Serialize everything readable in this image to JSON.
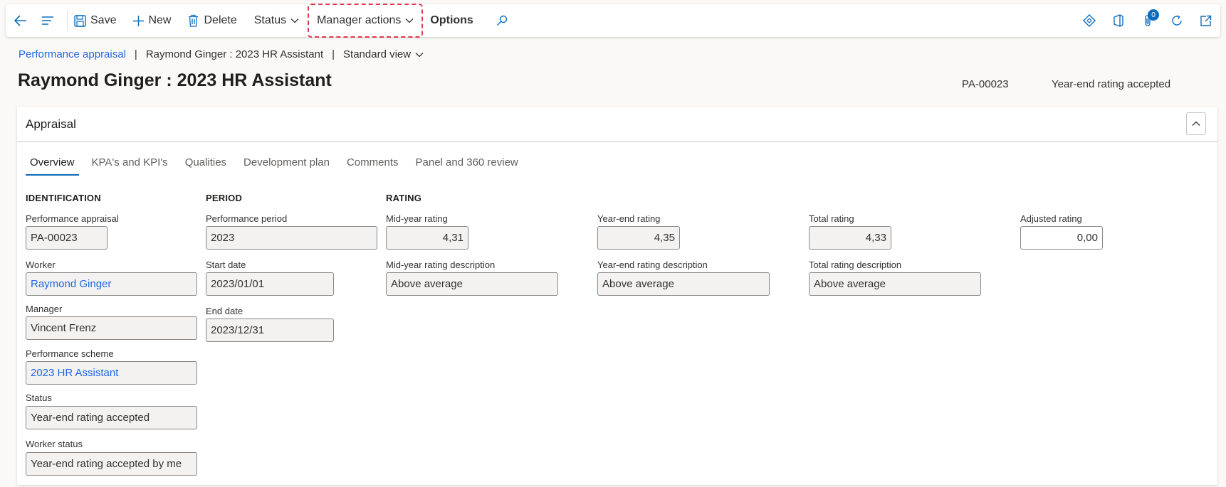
{
  "toolbar": {
    "save_label": "Save",
    "new_label": "New",
    "delete_label": "Delete",
    "status_label": "Status",
    "manager_actions_label": "Manager actions",
    "options_label": "Options",
    "notification_count": "0"
  },
  "breadcrumb": {
    "root": "Performance appraisal",
    "record": "Raymond Ginger : 2023 HR Assistant",
    "view": "Standard view"
  },
  "header": {
    "title": "Raymond Ginger : 2023 HR Assistant",
    "record_id": "PA-00023",
    "status": "Year-end rating accepted"
  },
  "card": {
    "title": "Appraisal",
    "tabs": [
      "Overview",
      "KPA's and KPI's",
      "Qualities",
      "Development plan",
      "Comments",
      "Panel and 360 review"
    ]
  },
  "identification": {
    "heading": "IDENTIFICATION",
    "appraisal_label": "Performance appraisal",
    "appraisal_value": "PA-00023",
    "worker_label": "Worker",
    "worker_value": "Raymond Ginger",
    "manager_label": "Manager",
    "manager_value": "Vincent Frenz",
    "scheme_label": "Performance scheme",
    "scheme_value": "2023 HR Assistant",
    "status_label": "Status",
    "status_value": "Year-end rating accepted",
    "worker_status_label": "Worker status",
    "worker_status_value": "Year-end rating accepted by me"
  },
  "period": {
    "heading": "PERIOD",
    "period_label": "Performance period",
    "period_value": "2023",
    "start_label": "Start date",
    "start_value": "2023/01/01",
    "end_label": "End date",
    "end_value": "2023/12/31"
  },
  "rating": {
    "heading": "RATING",
    "mid_label": "Mid-year rating",
    "mid_value": "4,31",
    "mid_desc_label": "Mid-year rating description",
    "mid_desc_value": "Above average",
    "year_end_label": "Year-end rating",
    "year_end_value": "4,35",
    "year_end_desc_label": "Year-end rating description",
    "year_end_desc_value": "Above average",
    "total_label": "Total rating",
    "total_value": "4,33",
    "total_desc_label": "Total rating description",
    "total_desc_value": "Above average",
    "adjusted_label": "Adjusted rating",
    "adjusted_value": "0,00"
  },
  "colors": {
    "accent": "#0f6cbd",
    "link": "#2266e3",
    "highlight": "#e03a4e"
  }
}
